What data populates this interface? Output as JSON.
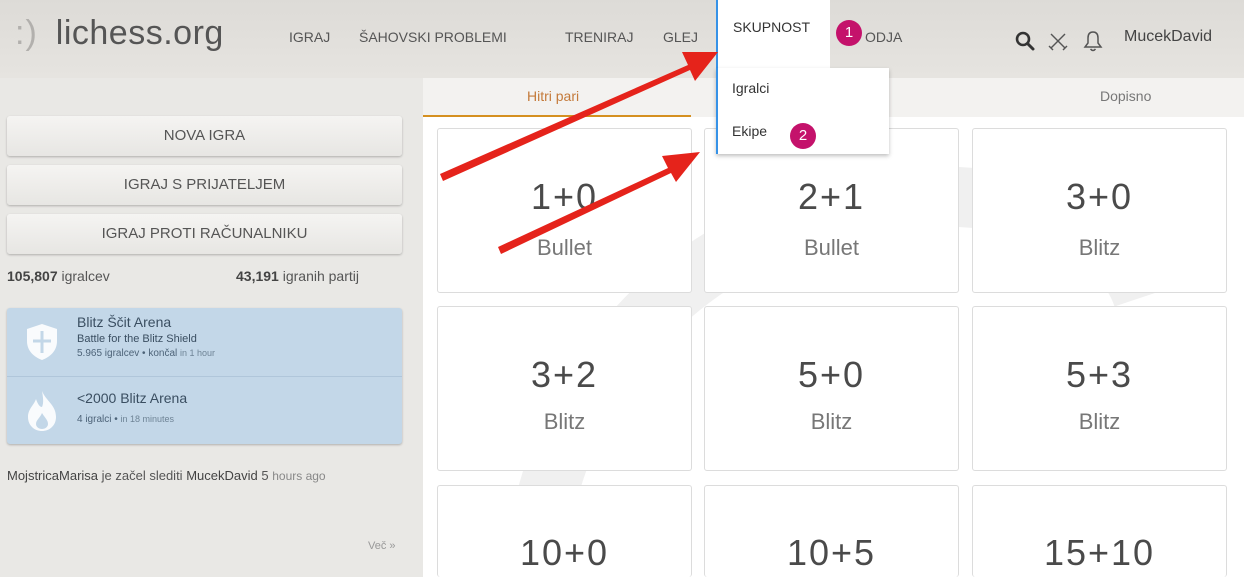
{
  "header": {
    "logo_smile": ":)",
    "logo_text": "lichess.org",
    "nav": [
      "IGRAJ",
      "ŠAHOVSKI PROBLEMI",
      "TRENIRAJ",
      "GLEJ"
    ],
    "nav_active": "SKUPNOST",
    "nav_partial": "ODJA",
    "username": "MucekDavid"
  },
  "dropdown": {
    "items": [
      "Igralci",
      "Ekipe"
    ]
  },
  "annotations": {
    "badge_1": "1",
    "badge_2": "2",
    "color": "#c4126b",
    "arrow_color": "#e5231b"
  },
  "sidebar": {
    "buttons": [
      "NOVA IGRA",
      "IGRAJ S PRIJATELJEM",
      "IGRAJ PROTI RAČUNALNIKU"
    ],
    "players_count": "105,807",
    "players_label": "igralcev",
    "games_count": "43,191",
    "games_label": "igranih partij",
    "tournaments": [
      {
        "icon": "shield-icon",
        "name": "Blitz Ščit Arena",
        "desc": "Battle for the Blitz Shield",
        "meta": "5.965 igralcev • končal",
        "when": "in 1 hour"
      },
      {
        "icon": "flame-icon",
        "name": "<2000 Blitz Arena",
        "desc": "",
        "meta": "4 igralci •",
        "when": "in 18 minutes"
      }
    ],
    "timeline": {
      "user": "MojstricaMarisa",
      "action": "je začel slediti",
      "target": "MucekDavid",
      "ago_num": "5",
      "ago_text": "hours ago"
    },
    "more": "Več »"
  },
  "lobby": {
    "tabs": [
      "Hitri pari",
      "Dopisno"
    ],
    "tiles": [
      {
        "time": "1+0",
        "type": "Bullet"
      },
      {
        "time": "2+1",
        "type": "Bullet"
      },
      {
        "time": "3+0",
        "type": "Blitz"
      },
      {
        "time": "3+2",
        "type": "Blitz"
      },
      {
        "time": "5+0",
        "type": "Blitz"
      },
      {
        "time": "5+3",
        "type": "Blitz"
      },
      {
        "time": "10+0",
        "type": ""
      },
      {
        "time": "10+5",
        "type": ""
      },
      {
        "time": "15+10",
        "type": ""
      }
    ]
  }
}
